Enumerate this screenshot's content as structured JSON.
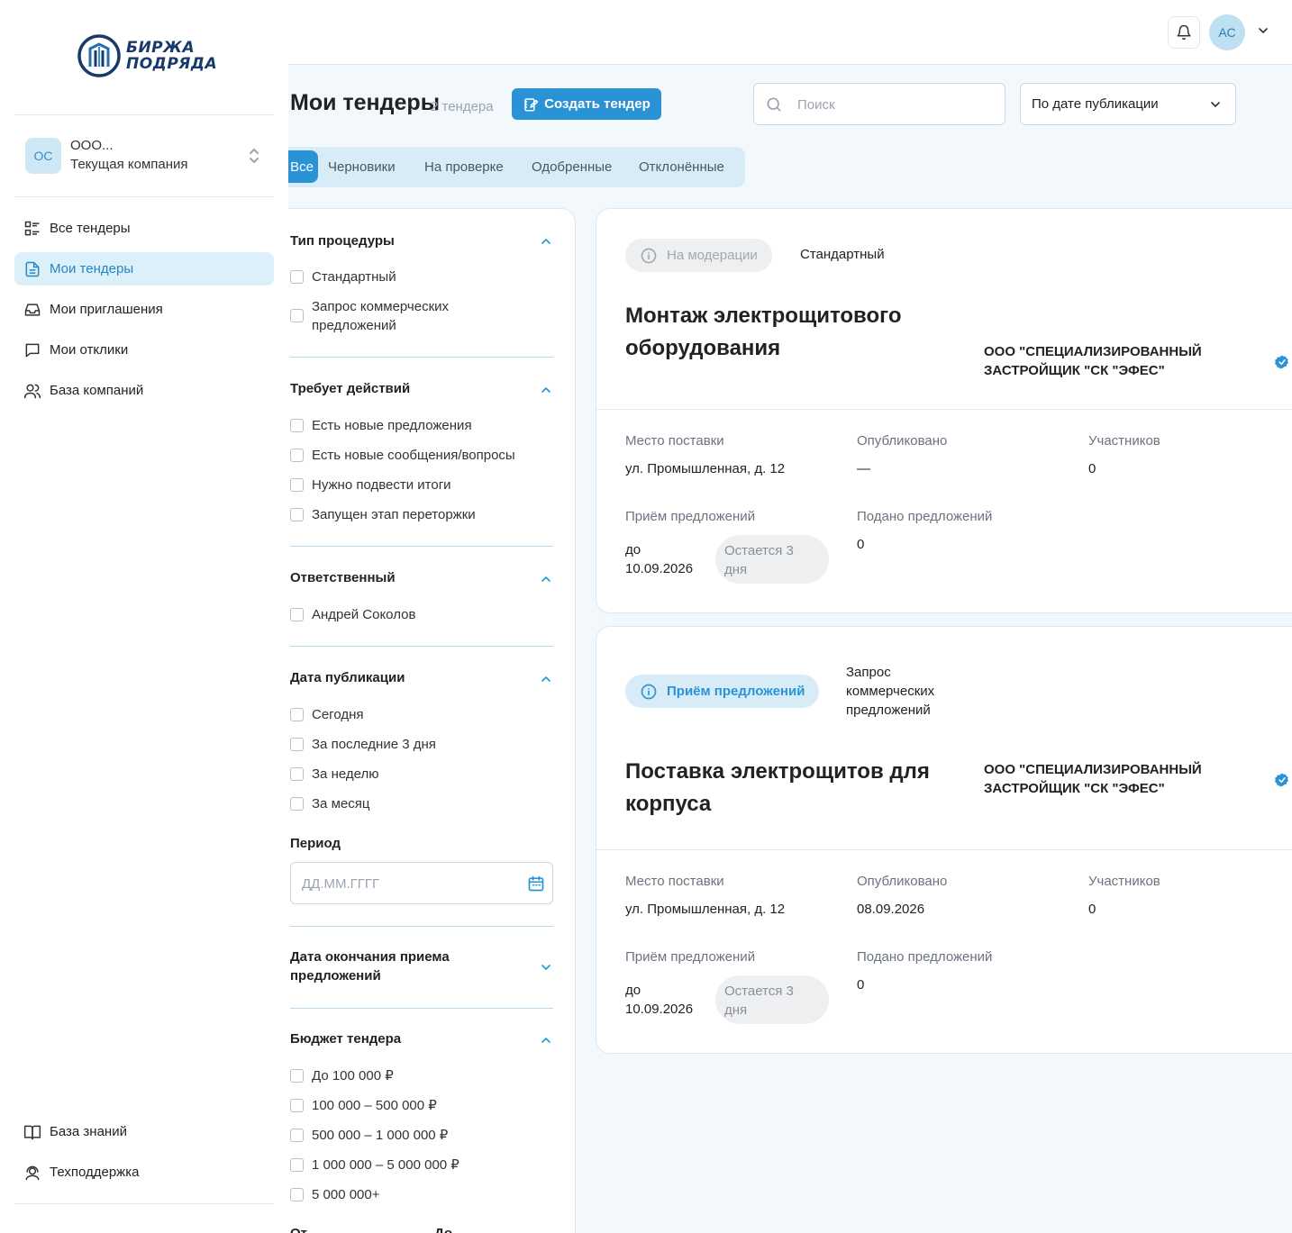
{
  "brand": {
    "line1": "БИРЖА",
    "line2": "ПОДРЯДА"
  },
  "company": {
    "initials": "ОС",
    "name": "ООО...",
    "subtitle": "Текущая компания"
  },
  "nav": [
    {
      "label": "Все тендеры",
      "icon": "list-icon",
      "active": false
    },
    {
      "label": "Мои тендеры",
      "icon": "document-icon",
      "active": true
    },
    {
      "label": "Мои приглашения",
      "icon": "inbox-icon",
      "active": false
    },
    {
      "label": "Мои отклики",
      "icon": "chat-icon",
      "active": false
    },
    {
      "label": "База компаний",
      "icon": "users-icon",
      "active": false
    }
  ],
  "nav_bottom": [
    {
      "label": "База знаний",
      "icon": "book-icon"
    },
    {
      "label": "Техподдержка",
      "icon": "support-icon"
    }
  ],
  "header": {
    "user_initials": "АС"
  },
  "page": {
    "title": "Мои тендеры",
    "count": "2 тендера",
    "create_label": "Создать тендер",
    "search_placeholder": "Поиск",
    "sort_value": "По дате публикации"
  },
  "tabs": [
    "Все",
    "Черновики",
    "На проверке",
    "Одобренные",
    "Отклонённые"
  ],
  "filters": {
    "procedure": {
      "title": "Тип процедуры",
      "options": [
        "Стандартный",
        "Запрос коммерческих предложений"
      ]
    },
    "actions": {
      "title": "Требует действий",
      "options": [
        "Есть новые предложения",
        "Есть новые сообщения/вопросы",
        "Нужно подвести итоги",
        "Запущен этап переторжки"
      ]
    },
    "responsible": {
      "title": "Ответственный",
      "options": [
        "Андрей Соколов"
      ]
    },
    "pub_date": {
      "title": "Дата публикации",
      "options": [
        "Сегодня",
        "За последние 3 дня",
        "За неделю",
        "За месяц"
      ]
    },
    "period": {
      "label": "Период",
      "placeholder": "ДД.ММ.ГГГГ"
    },
    "end_date": {
      "title": "Дата окончания приема предложений"
    },
    "budget": {
      "title": "Бюджет тендера",
      "options": [
        "До 100 000 ₽",
        "100 000 – 500 000 ₽",
        "500 000 – 1 000 000 ₽",
        "1 000 000 – 5 000 000 ₽",
        "5 000 000+"
      ]
    },
    "range": {
      "from": "От",
      "to": "До"
    }
  },
  "labels": {
    "place": "Место поставки",
    "published": "Опубликовано",
    "participants": "Участников",
    "reception": "Приём предложений",
    "submitted": "Подано предложений"
  },
  "tenders": [
    {
      "status": "На модерации",
      "type": "Стандартный",
      "title": "Монтаж электрощитового оборудования",
      "org": "ООО \"СПЕЦИАЛИЗИРОВАННЫЙ ЗАСТРОЙЩИК \"СК \"ЭФЕС\"",
      "place": "ул. Промышленная, д. 12",
      "published": "—",
      "participants": "0",
      "deadline": "до 10.09.2026",
      "remaining": "Остается 3 дня",
      "submitted": "0"
    },
    {
      "status": "Приём предложений",
      "type": "Запрос коммерческих предложений",
      "title": "Поставка электрощитов для корпуса",
      "org": "ООО \"СПЕЦИАЛИЗИРОВАННЫЙ ЗАСТРОЙЩИК \"СК \"ЭФЕС\"",
      "place": "ул. Промышленная, д. 12",
      "published": "08.09.2026",
      "participants": "0",
      "deadline": "до 10.09.2026",
      "remaining": "Остается 3 дня",
      "submitted": "0"
    }
  ],
  "colors": {
    "accent": "#2a93d6",
    "active_bg": "#dcf0fa",
    "page_bg": "#f3f8fc"
  }
}
